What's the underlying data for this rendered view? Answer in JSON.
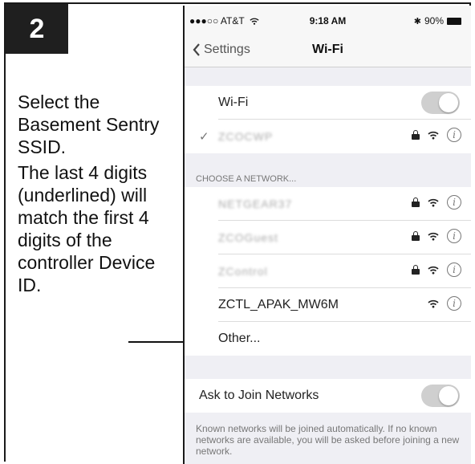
{
  "step": "2",
  "instructions": {
    "line1": "Select the Basement Sentry SSID.",
    "line2": "The last 4 digits (underlined) will match the first 4 digits of the controller Device ID."
  },
  "status_bar": {
    "carrier": "●●●○○ AT&T",
    "time": "9:18 AM",
    "battery": "90%"
  },
  "nav": {
    "back_label": "Settings",
    "title": "Wi-Fi"
  },
  "wifi_row": {
    "label": "Wi-Fi",
    "toggle_on": true
  },
  "connected_network": {
    "name": "ZCOCWP",
    "secured": true
  },
  "section_header": "CHOOSE A NETWORK...",
  "networks": [
    {
      "name": "NETGEAR37",
      "secured": true
    },
    {
      "name": "ZCOGuest",
      "secured": true
    },
    {
      "name": "ZControl",
      "secured": true
    },
    {
      "name": "ZCTL_APAK_MW6M",
      "secured": false
    }
  ],
  "other_label": "Other...",
  "ask_to_join": {
    "label": "Ask to Join Networks",
    "toggle_on": true
  },
  "footer_note": "Known networks will be joined automatically. If no known networks are available, you will be asked before joining a new network.",
  "colors": {
    "toggle_track": "#cfcfcf",
    "badge_bg": "#1f1f1f",
    "group_bg": "#efeff4"
  }
}
